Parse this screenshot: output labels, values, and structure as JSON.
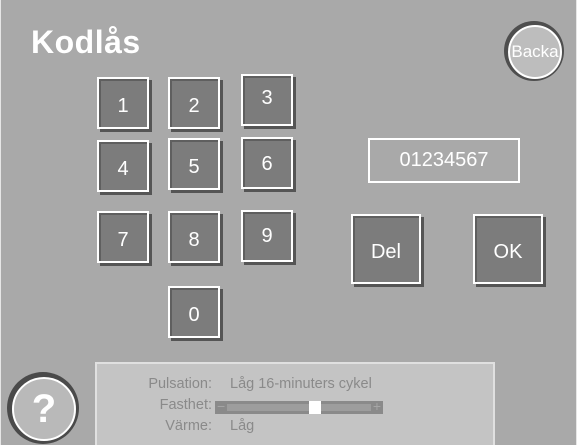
{
  "header": {
    "title": "Kodlås",
    "back_label": "Backa"
  },
  "keypad": {
    "keys": [
      "1",
      "2",
      "3",
      "4",
      "5",
      "6",
      "7",
      "8",
      "9",
      "0"
    ]
  },
  "display": {
    "code": "01234567"
  },
  "actions": {
    "delete_label": "Del",
    "ok_label": "OK"
  },
  "help": {
    "label": "?"
  },
  "status": {
    "pulsation_label": "Pulsation:",
    "pulsation_value": "Låg 16-minuters cykel",
    "firmness_label": "Fasthet:",
    "firmness_minus": "−",
    "firmness_plus": "+",
    "firmness_level": 0.62,
    "heat_label": "Värme:",
    "heat_value": "Låg"
  },
  "colors": {
    "background": "#a9a9a9",
    "key_face": "#7c7c7c",
    "text": "#ffffff",
    "status_panel": "#c4c4c4"
  }
}
